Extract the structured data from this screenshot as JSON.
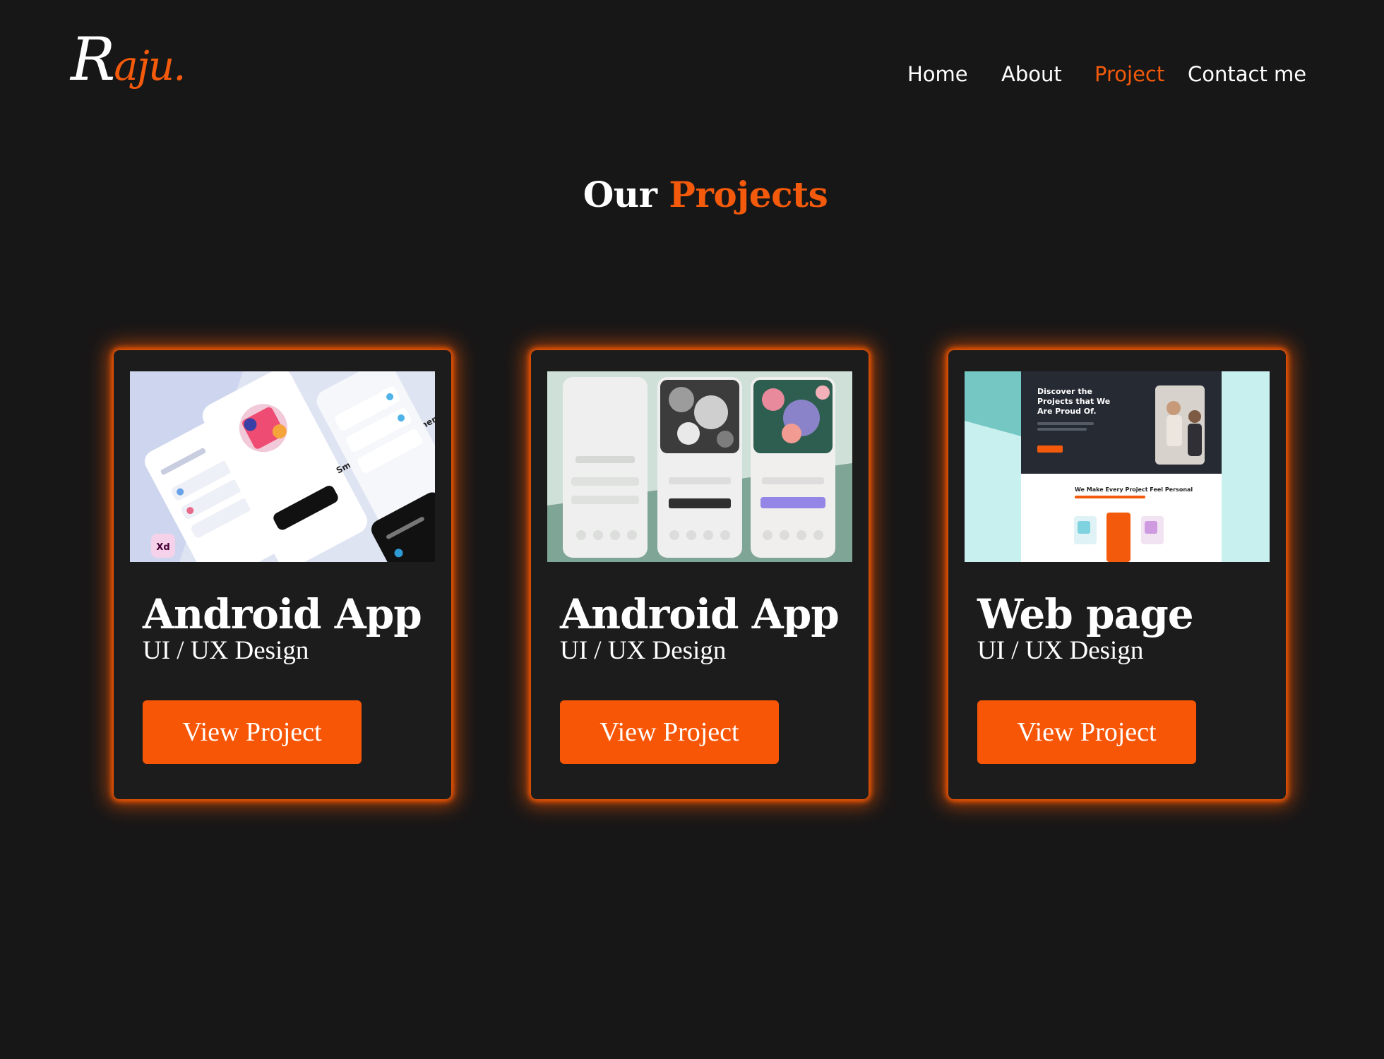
{
  "logo": {
    "first": "R",
    "rest": "aju."
  },
  "nav": {
    "items": [
      {
        "label": "Home",
        "active": false
      },
      {
        "label": "About",
        "active": false
      },
      {
        "label": "Project",
        "active": true
      },
      {
        "label": "Contact me",
        "active": false
      }
    ]
  },
  "heading": {
    "prefix": "Our",
    "accent": "Projects"
  },
  "projects": [
    {
      "title": "Android App",
      "subtitle": "UI / UX Design",
      "button": "View Project"
    },
    {
      "title": "Android App",
      "subtitle": "UI / UX Design",
      "button": "View Project"
    },
    {
      "title": "Web page",
      "subtitle": "UI / UX Design",
      "button": "View Project"
    }
  ],
  "thumbnail_text": {
    "p1_heading": "Smart task Management",
    "p1_badge": "Xd",
    "p3_heading_1": "Discover the",
    "p3_heading_2": "Projects that We",
    "p3_heading_3": "Are Proud Of.",
    "p3_subheading": "We Make Every Project Feel Personal"
  },
  "colors": {
    "accent": "#f45a0b",
    "button": "#f75606",
    "background": "#181717",
    "card": "#1d1c1c"
  }
}
